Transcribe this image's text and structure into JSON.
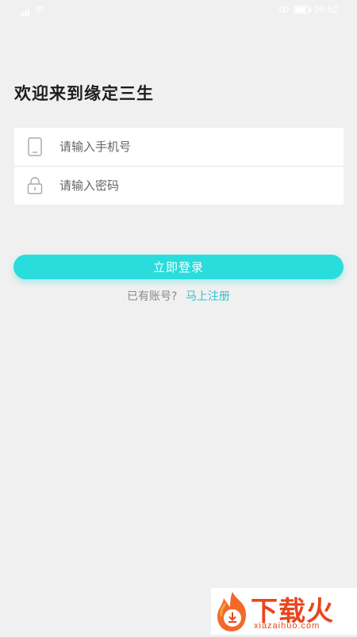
{
  "status_bar": {
    "time": "09:52",
    "colors": {
      "icons": "#ffffff"
    }
  },
  "welcome": {
    "title": "欢迎来到缘定三生"
  },
  "form": {
    "phone": {
      "placeholder": "请输入手机号",
      "value": "",
      "icon": "phone-icon"
    },
    "password": {
      "placeholder": "请输入密码",
      "value": "",
      "icon": "lock-icon"
    }
  },
  "login_button": {
    "label": "立即登录",
    "color": "#2adcdc"
  },
  "register": {
    "prompt": "已有账号?",
    "link": "马上注册",
    "link_color": "#2fc4cf"
  },
  "watermark": {
    "text": "下载火",
    "url": "xiazaihuo.com",
    "color": "#e8461d"
  }
}
